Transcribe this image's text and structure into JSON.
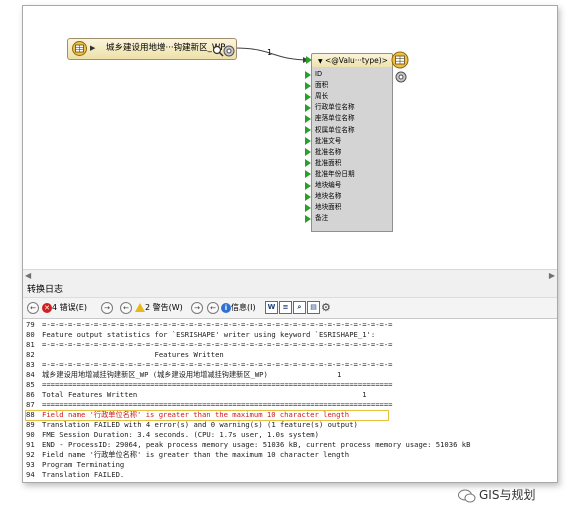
{
  "workspace": {
    "reader": {
      "label": "城乡建设用地增···钩建新区_WP"
    },
    "connection": {
      "count": "1"
    },
    "writer": {
      "label": "<@Valu···type)>",
      "attributes": [
        "ID",
        "面积",
        "周长",
        "行政单位名称",
        "座落单位名称",
        "权属单位名称",
        "批准文号",
        "批准名称",
        "批准面积",
        "批准年份日期",
        "地块编号",
        "地块名称",
        "地块面积",
        "备注"
      ]
    }
  },
  "log_panel": {
    "title": "转换日志",
    "toolbar": {
      "errors_count": "4",
      "errors_label": "错误(E)",
      "warnings_count": "2",
      "warnings_label": "警告(W)",
      "info_label": "信息(I)"
    },
    "lines": [
      {
        "n": "79",
        "text": "=-=-=-=-=-=-=-=-=-=-=-=-=-=-=-=-=-=-=-=-=-=-=-=-=-=-=-=-=-=-=-=-=-=-=-=-=-=-=-=-=",
        "error": false
      },
      {
        "n": "80",
        "text": "Feature output statistics for `ESRISHAPE' writer using keyword `ESRISHAPE_1':",
        "error": false
      },
      {
        "n": "81",
        "text": "=-=-=-=-=-=-=-=-=-=-=-=-=-=-=-=-=-=-=-=-=-=-=-=-=-=-=-=-=-=-=-=-=-=-=-=-=-=-=-=-=",
        "error": false
      },
      {
        "n": "82",
        "text": "                          Features Written",
        "error": false
      },
      {
        "n": "83",
        "text": "=-=-=-=-=-=-=-=-=-=-=-=-=-=-=-=-=-=-=-=-=-=-=-=-=-=-=-=-=-=-=-=-=-=-=-=-=-=-=-=-=",
        "error": false
      },
      {
        "n": "84",
        "text": "城乡建设用地增减挂钩建新区_WP (城乡建设用地增减挂钩建新区_WP)                1",
        "error": false
      },
      {
        "n": "85",
        "text": "=================================================================================",
        "error": false
      },
      {
        "n": "86",
        "text": "Total Features Written                                                    1",
        "error": false
      },
      {
        "n": "87",
        "text": "=================================================================================",
        "error": false
      },
      {
        "n": "88",
        "text": "Field name '行政单位名称' is greater than the maximum 10 character length",
        "error": true
      },
      {
        "n": "89",
        "text": "Translation FAILED with 4 error(s) and 0 warning(s) (1 feature(s) output)",
        "error": false
      },
      {
        "n": "90",
        "text": "FME Session Duration: 3.4 seconds. (CPU: 1.7s user, 1.0s system)",
        "error": false
      },
      {
        "n": "91",
        "text": "END - ProcessID: 29064, peak process memory usage: 51036 kB, current process memory usage: 51036 kB",
        "error": false
      },
      {
        "n": "92",
        "text": "Field name '行政单位名称' is greater than the maximum 10 character length",
        "error": false
      },
      {
        "n": "93",
        "text": "Program Terminating",
        "error": false
      },
      {
        "n": "94",
        "text": "Translation FAILED.",
        "error": false
      }
    ]
  },
  "watermark": {
    "text": "GIS与规划"
  },
  "colors": {
    "port_green": "#28a028",
    "error_red": "#d01818",
    "node_fill": "#eee0a8"
  }
}
